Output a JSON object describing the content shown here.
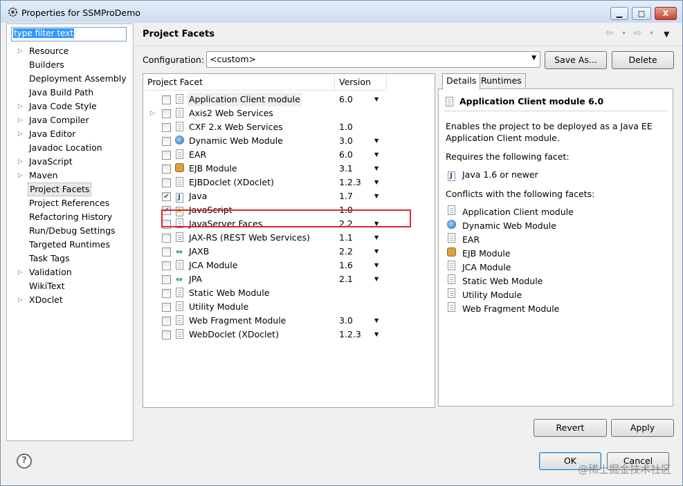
{
  "window": {
    "title": "Properties for SSMProDemo",
    "buttons": {
      "minimize": "▁",
      "maximize": "□",
      "close": "X"
    }
  },
  "filter": {
    "placeholder": "type filter text",
    "value": "type filter text"
  },
  "tree": [
    {
      "label": "Resource",
      "expandable": true
    },
    {
      "label": "Builders",
      "expandable": false
    },
    {
      "label": "Deployment Assembly",
      "expandable": false
    },
    {
      "label": "Java Build Path",
      "expandable": false
    },
    {
      "label": "Java Code Style",
      "expandable": true
    },
    {
      "label": "Java Compiler",
      "expandable": true
    },
    {
      "label": "Java Editor",
      "expandable": true
    },
    {
      "label": "Javadoc Location",
      "expandable": false
    },
    {
      "label": "JavaScript",
      "expandable": true
    },
    {
      "label": "Maven",
      "expandable": true
    },
    {
      "label": "Project Facets",
      "expandable": false,
      "selected": true
    },
    {
      "label": "Project References",
      "expandable": false
    },
    {
      "label": "Refactoring History",
      "expandable": false
    },
    {
      "label": "Run/Debug Settings",
      "expandable": false
    },
    {
      "label": "Targeted Runtimes",
      "expandable": false
    },
    {
      "label": "Task Tags",
      "expandable": false
    },
    {
      "label": "Validation",
      "expandable": true
    },
    {
      "label": "WikiText",
      "expandable": false
    },
    {
      "label": "XDoclet",
      "expandable": true
    }
  ],
  "page": {
    "title": "Project Facets",
    "nav": {
      "back": "⇦",
      "back_menu": "▾",
      "forward": "⇨",
      "forward_menu": "▾",
      "view_menu": "▼"
    }
  },
  "configuration": {
    "label": "Configuration:",
    "value": "<custom>",
    "save_as": "Save As...",
    "delete": "Delete"
  },
  "facets": {
    "col_facet": "Project Facet",
    "col_version": "Version",
    "rows": [
      {
        "name": "Application Client module",
        "version": "6.0",
        "checked": false,
        "dropdown": true,
        "icon": "page",
        "highlighted": true
      },
      {
        "name": "Axis2 Web Services",
        "version": "",
        "checked": false,
        "dropdown": false,
        "icon": "page",
        "expander": true
      },
      {
        "name": "CXF 2.x Web Services",
        "version": "1.0",
        "checked": false,
        "dropdown": false,
        "icon": "page"
      },
      {
        "name": "Dynamic Web Module",
        "version": "3.0",
        "checked": false,
        "dropdown": true,
        "icon": "globe"
      },
      {
        "name": "EAR",
        "version": "6.0",
        "checked": false,
        "dropdown": true,
        "icon": "page"
      },
      {
        "name": "EJB Module",
        "version": "3.1",
        "checked": false,
        "dropdown": true,
        "icon": "bean"
      },
      {
        "name": "EJBDoclet (XDoclet)",
        "version": "1.2.3",
        "checked": false,
        "dropdown": true,
        "icon": "page"
      },
      {
        "name": "Java",
        "version": "1.7",
        "checked": true,
        "dropdown": true,
        "icon": "java"
      },
      {
        "name": "JavaScript",
        "version": "1.0",
        "checked": true,
        "dropdown": false,
        "icon": "js"
      },
      {
        "name": "JavaServer Faces",
        "version": "2.2",
        "checked": false,
        "dropdown": true,
        "icon": "page"
      },
      {
        "name": "JAX-RS (REST Web Services)",
        "version": "1.1",
        "checked": false,
        "dropdown": true,
        "icon": "page"
      },
      {
        "name": "JAXB",
        "version": "2.2",
        "checked": false,
        "dropdown": true,
        "icon": "arrows"
      },
      {
        "name": "JCA Module",
        "version": "1.6",
        "checked": false,
        "dropdown": true,
        "icon": "page"
      },
      {
        "name": "JPA",
        "version": "2.1",
        "checked": false,
        "dropdown": true,
        "icon": "arrows"
      },
      {
        "name": "Static Web Module",
        "version": "",
        "checked": false,
        "dropdown": false,
        "icon": "page"
      },
      {
        "name": "Utility Module",
        "version": "",
        "checked": false,
        "dropdown": false,
        "icon": "page"
      },
      {
        "name": "Web Fragment Module",
        "version": "3.0",
        "checked": false,
        "dropdown": true,
        "icon": "page"
      },
      {
        "name": "WebDoclet (XDoclet)",
        "version": "1.2.3",
        "checked": false,
        "dropdown": true,
        "icon": "page"
      }
    ]
  },
  "details": {
    "tabs": [
      "Details",
      "Runtimes"
    ],
    "title": "Application Client module 6.0",
    "description_line1": "Enables the project to be deployed as a Java EE",
    "description_line2": "Application Client module.",
    "requires_label": "Requires the following facet:",
    "requires": [
      {
        "name": "Java 1.6 or newer",
        "icon": "java"
      }
    ],
    "conflicts_label": "Conflicts with the following facets:",
    "conflicts": [
      {
        "name": "Application Client module",
        "icon": "page"
      },
      {
        "name": "Dynamic Web Module",
        "icon": "globe"
      },
      {
        "name": "EAR",
        "icon": "page"
      },
      {
        "name": "EJB Module",
        "icon": "bean"
      },
      {
        "name": "JCA Module",
        "icon": "page"
      },
      {
        "name": "Static Web Module",
        "icon": "page"
      },
      {
        "name": "Utility Module",
        "icon": "page"
      },
      {
        "name": "Web Fragment Module",
        "icon": "page"
      }
    ]
  },
  "actions": {
    "revert": "Revert",
    "apply": "Apply"
  },
  "footer": {
    "help": "?",
    "ok": "OK",
    "cancel": "Cancel",
    "watermark": "@稀土掘金技术社区"
  },
  "colors": {
    "highlight_box": "#d9272e",
    "selection": "#3399ff"
  }
}
